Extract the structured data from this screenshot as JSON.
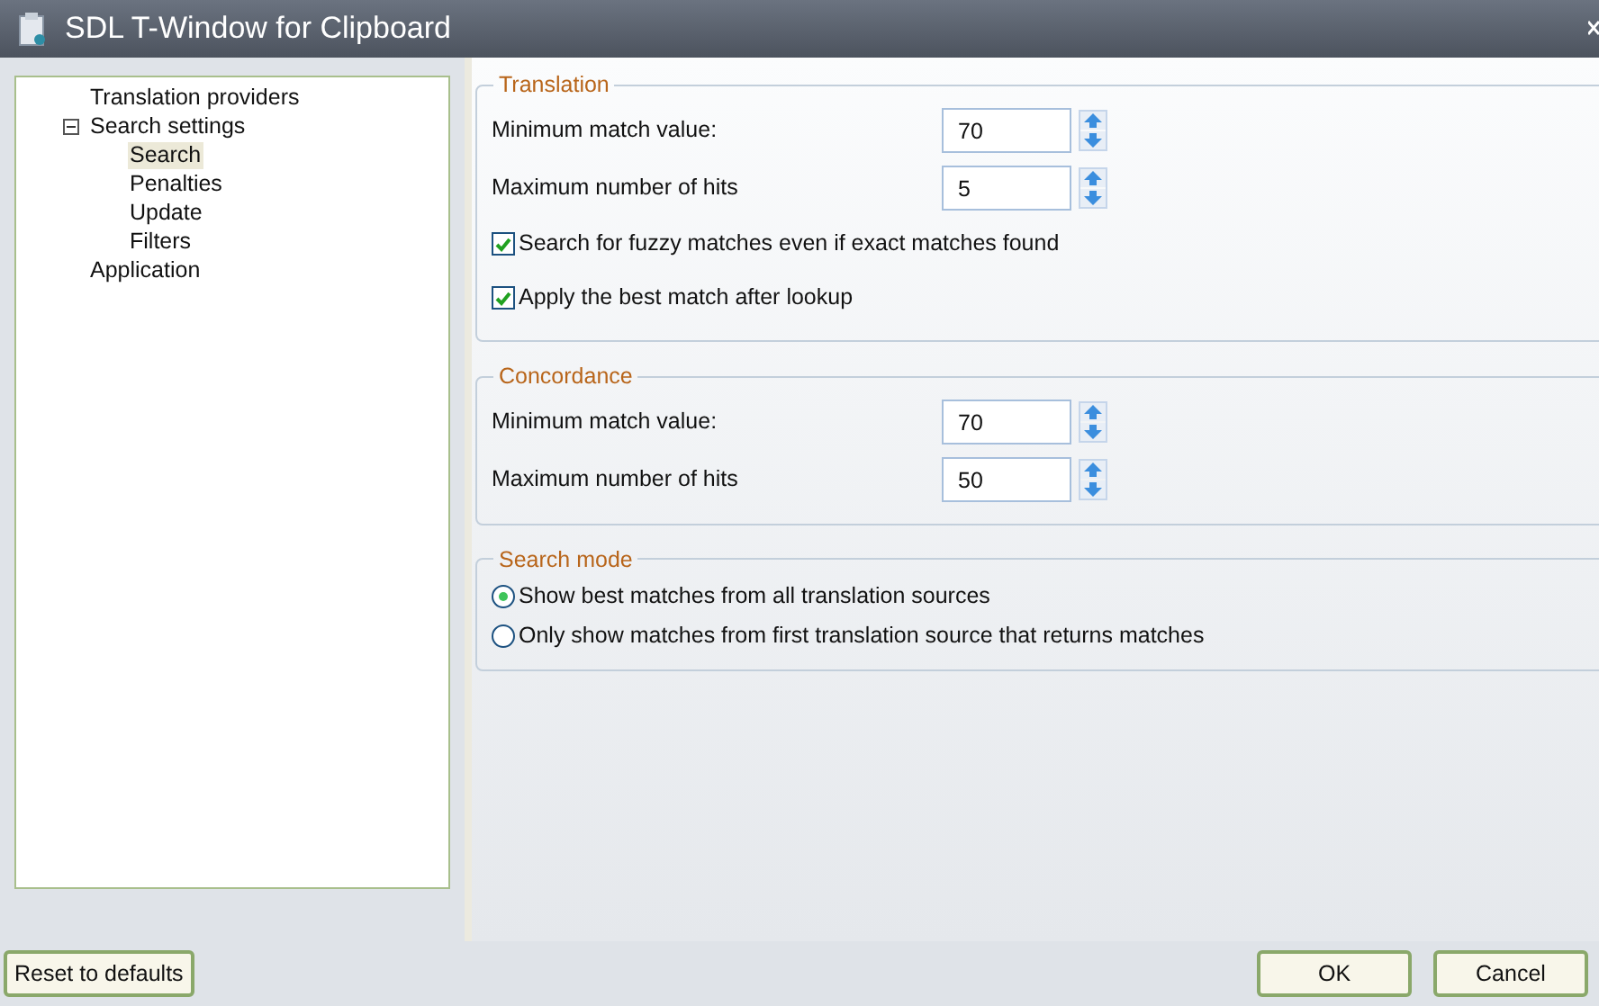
{
  "window": {
    "title": "SDL T-Window for Clipboard"
  },
  "tree": [
    {
      "label": "Translation providers",
      "selected": false
    },
    {
      "label": "Search settings",
      "selected": false,
      "expanded": true,
      "children": [
        {
          "label": "Search",
          "selected": true
        },
        {
          "label": "Penalties",
          "selected": false
        },
        {
          "label": "Update",
          "selected": false
        },
        {
          "label": "Filters",
          "selected": false
        }
      ]
    },
    {
      "label": "Application",
      "selected": false
    }
  ],
  "groups": [
    {
      "title": "Translation",
      "items": [
        {
          "kind": "spin",
          "label": "Minimum match value:",
          "value": "70"
        },
        {
          "kind": "spin",
          "label": "Maximum number of hits",
          "value": "5"
        },
        {
          "kind": "check",
          "label": "Search for fuzzy matches even if exact matches found",
          "checked": true
        },
        {
          "kind": "check",
          "label": "Apply the best match after lookup",
          "checked": true
        }
      ]
    },
    {
      "title": "Concordance",
      "items": [
        {
          "kind": "spin",
          "label": "Minimum match value:",
          "value": "70"
        },
        {
          "kind": "spin",
          "label": "Maximum number of hits",
          "value": "50"
        }
      ]
    },
    {
      "title": "Search mode",
      "items": [
        {
          "kind": "radio",
          "label": "Show best matches from all translation sources",
          "selected": true
        },
        {
          "kind": "radio",
          "label": "Only show matches from first translation source that returns matches",
          "selected": false
        }
      ]
    }
  ],
  "buttons": {
    "reset": "Reset to defaults",
    "ok": "OK",
    "cancel": "Cancel"
  }
}
